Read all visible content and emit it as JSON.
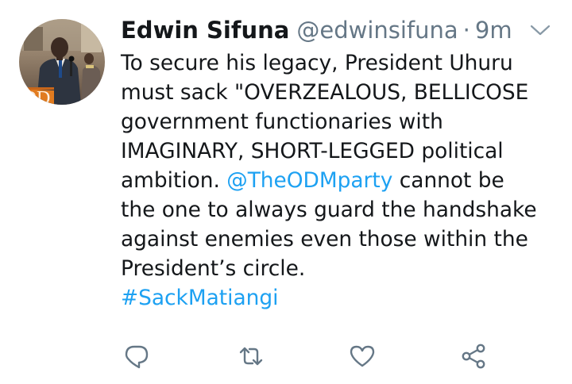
{
  "tweet": {
    "author_name": "Edwin Sifuna",
    "handle": "@edwinsifuna",
    "separator": "·",
    "time": "9m",
    "lines": [
      [
        {
          "text": "To secure his legacy, President Uhuru",
          "link": false
        }
      ],
      [
        {
          "text": "must sack \"OVERZEALOUS, BELLICOSE",
          "link": false
        }
      ],
      [
        {
          "text": "government functionaries with",
          "link": false
        }
      ],
      [
        {
          "text": "IMAGINARY, SHORT-LEGGED political",
          "link": false
        }
      ],
      [
        {
          "text": "ambition. ",
          "link": false
        },
        {
          "text": "@TheODMparty",
          "link": true
        },
        {
          "text": " cannot be",
          "link": false
        }
      ],
      [
        {
          "text": "the one to always guard the handshake",
          "link": false
        }
      ],
      [
        {
          "text": "against enemies even those within the",
          "link": false
        }
      ],
      [
        {
          "text": "President’s circle.",
          "link": false
        }
      ],
      [
        {
          "text": "#SackMatiangi",
          "link": true
        }
      ]
    ],
    "avatar_sign_text": "OD"
  },
  "icons": {
    "chevron": "chevron-down-icon",
    "reply": "reply-icon",
    "retweet": "retweet-icon",
    "like": "heart-icon",
    "share": "share-icon"
  },
  "colors": {
    "text": "#14171a",
    "secondary": "#657786",
    "link": "#1da1f2",
    "icon": "#657786"
  }
}
